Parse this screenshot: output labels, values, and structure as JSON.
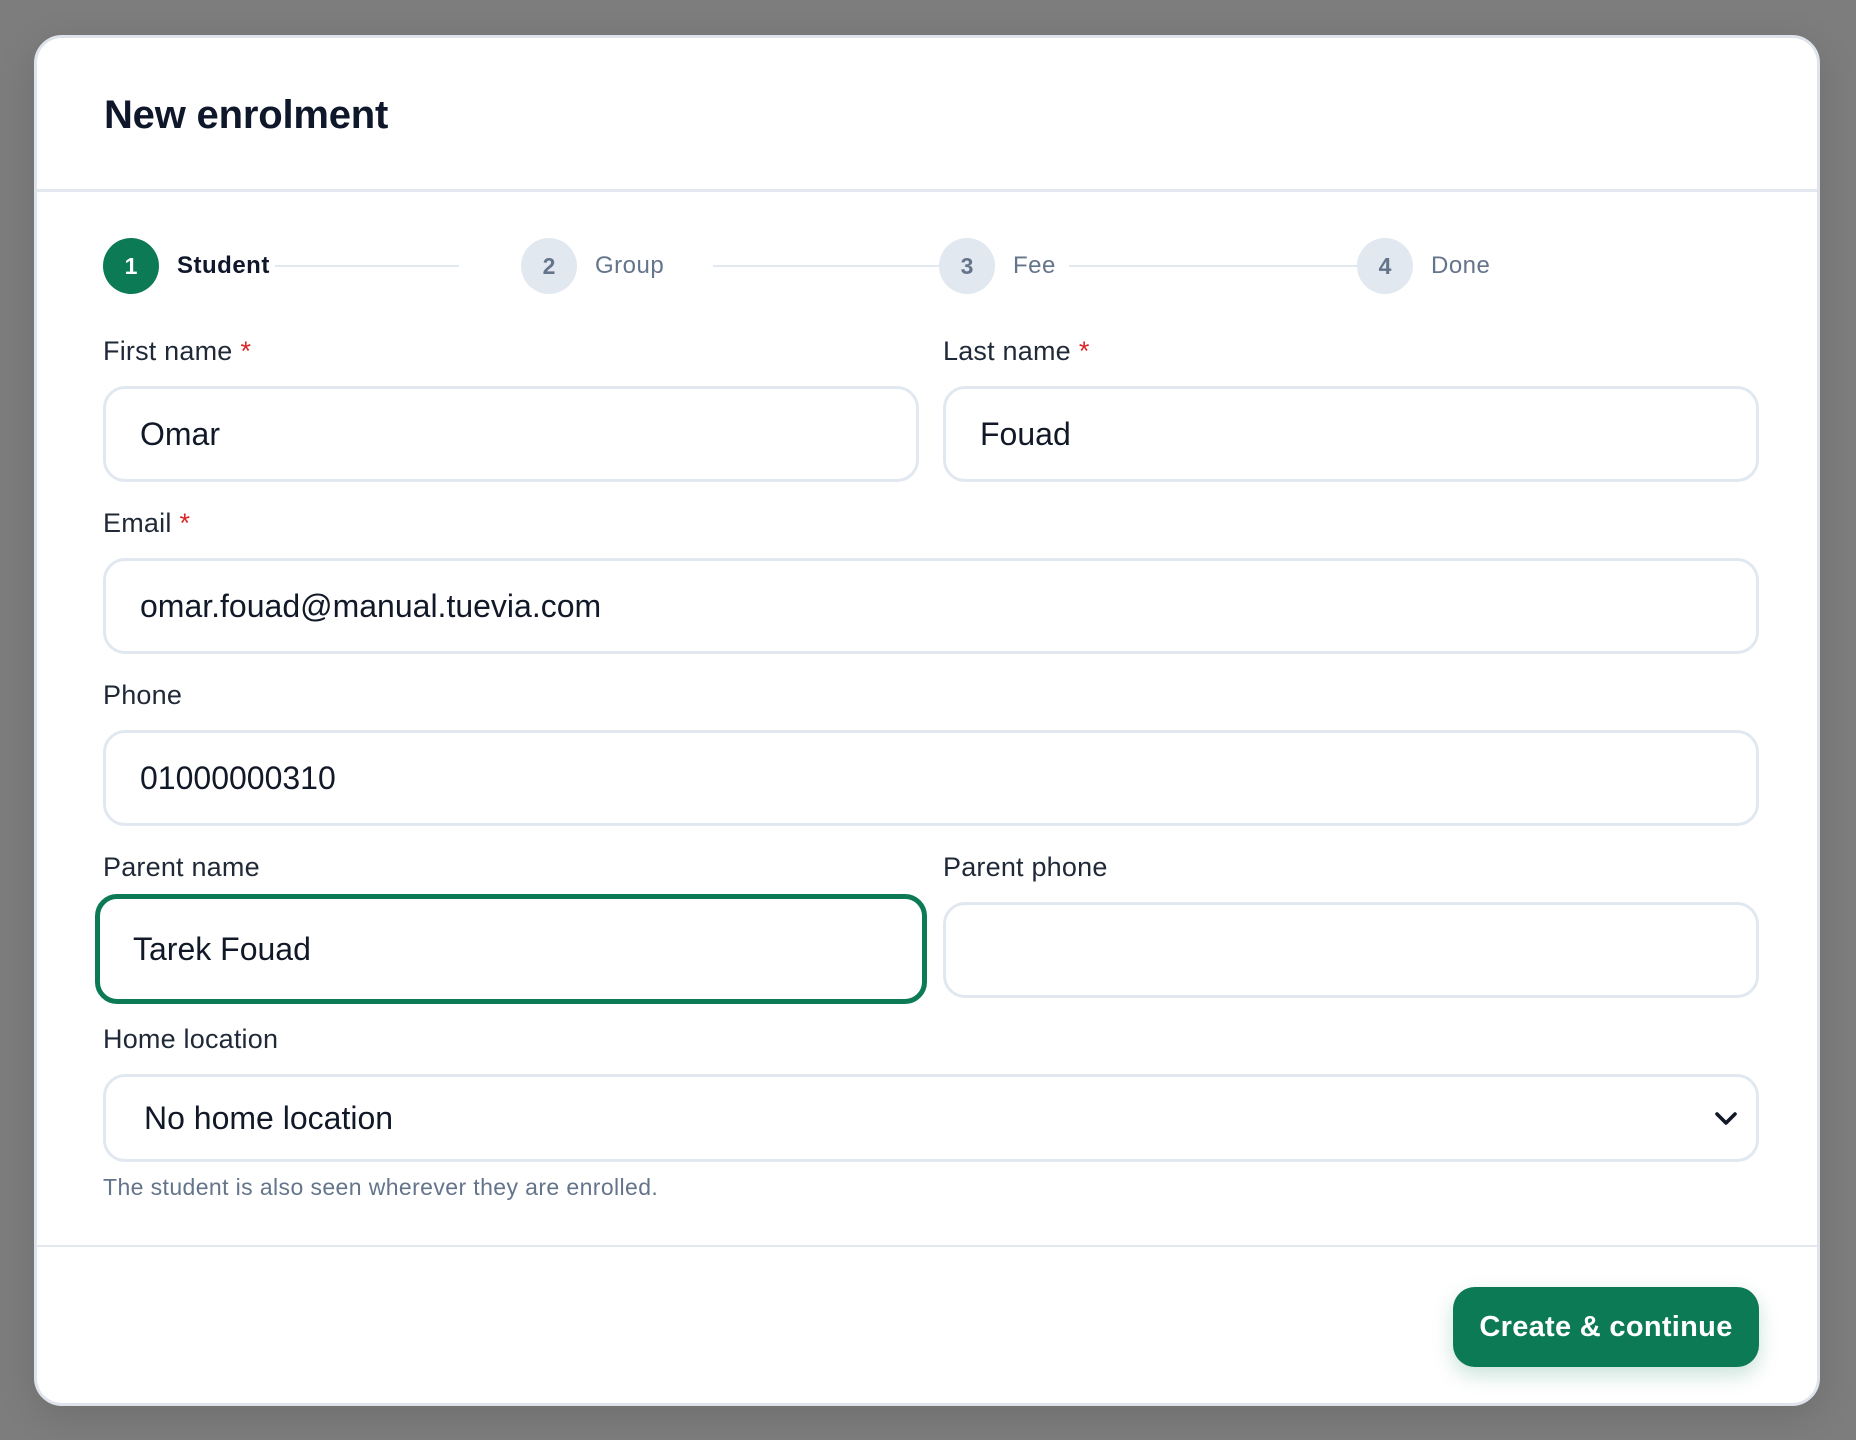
{
  "dialog": {
    "title": "New enrolment"
  },
  "stepper": {
    "steps": [
      {
        "number": "1",
        "label": "Student",
        "state": "active"
      },
      {
        "number": "2",
        "label": "Group",
        "state": "inactive"
      },
      {
        "number": "3",
        "label": "Fee",
        "state": "inactive"
      },
      {
        "number": "4",
        "label": "Done",
        "state": "inactive"
      }
    ]
  },
  "form": {
    "required_marker": "*",
    "first_name": {
      "label": "First name",
      "value": "Omar",
      "required": true
    },
    "last_name": {
      "label": "Last name",
      "value": "Fouad",
      "required": true
    },
    "email": {
      "label": "Email",
      "value": "omar.fouad@manual.tuevia.com",
      "required": true
    },
    "phone": {
      "label": "Phone",
      "value": "01000000310"
    },
    "parent_name": {
      "label": "Parent name",
      "value": "Tarek Fouad",
      "focused": true
    },
    "parent_phone": {
      "label": "Parent phone",
      "value": ""
    },
    "home_location": {
      "label": "Home location",
      "selected": "No home location",
      "icon": "chevron-down-icon",
      "hint": "The student is also seen wherever they are enrolled."
    }
  },
  "footer": {
    "primary_label": "Create & continue"
  },
  "colors": {
    "accent": "#0b7a55",
    "required": "#dc2626",
    "overlay": "#7d7d7d"
  }
}
